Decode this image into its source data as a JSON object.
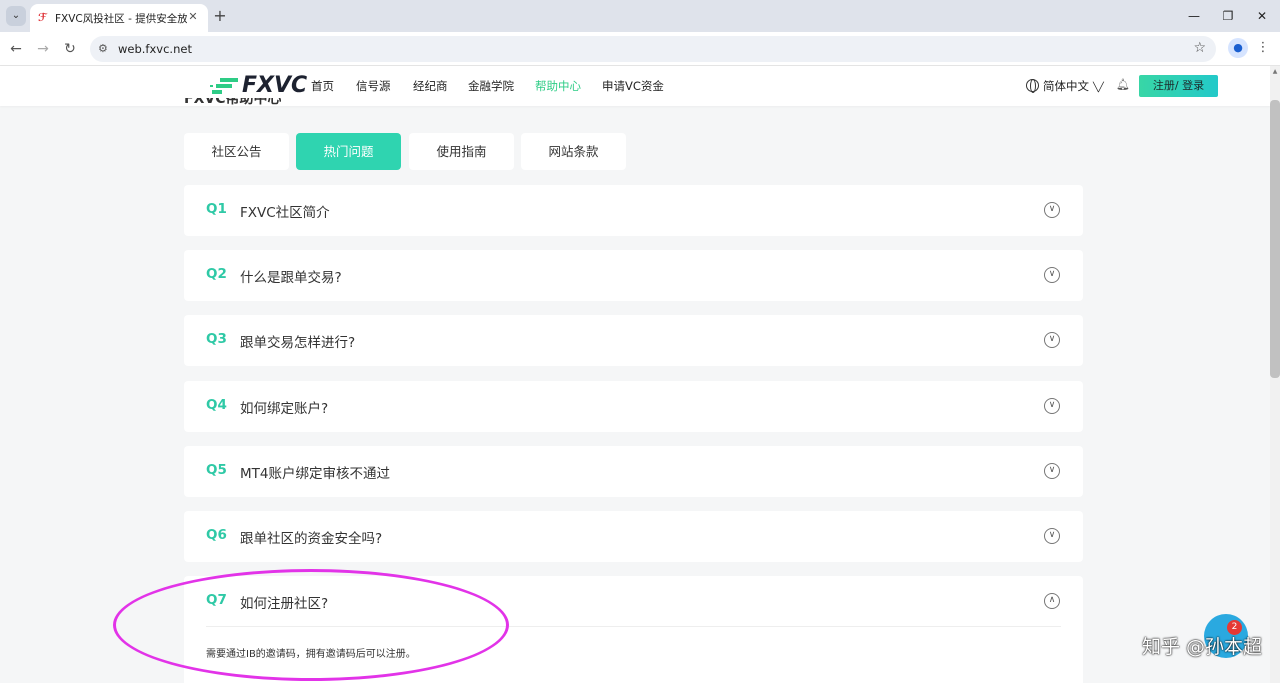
{
  "browser": {
    "tab_title": "FXVC风投社区 - 提供安全放心的",
    "url": "web.fxvc.net"
  },
  "header": {
    "logo_text": "FXVC",
    "nav": [
      "首页",
      "信号源",
      "经纪商",
      "金融学院",
      "帮助中心",
      "申请VC资金"
    ],
    "active_nav": "帮助中心",
    "language": "简体中文",
    "login_label": "注册/ 登录"
  },
  "page": {
    "title": "FXVC帮助中心",
    "tabs": [
      "社区公告",
      "热门问题",
      "使用指南",
      "网站条款"
    ],
    "active_tab": "热门问题"
  },
  "faq": [
    {
      "num": "Q1",
      "question": "FXVC社区简介"
    },
    {
      "num": "Q2",
      "question": "什么是跟单交易?"
    },
    {
      "num": "Q3",
      "question": "跟单交易怎样进行?"
    },
    {
      "num": "Q4",
      "question": "如何绑定账户?"
    },
    {
      "num": "Q5",
      "question": "MT4账户绑定审核不通过"
    },
    {
      "num": "Q6",
      "question": "跟单社区的资金安全吗?"
    },
    {
      "num": "Q7",
      "question": "如何注册社区?",
      "answer": "需要通过IB的邀请码，拥有邀请码后可以注册。",
      "expanded": true
    }
  ],
  "chat": {
    "badge_count": "2"
  },
  "watermark": "知乎 @孙本超",
  "colors": {
    "accent": "#2fd4b0",
    "active_nav": "#2ecc86",
    "annotation": "#e233e8",
    "chat": "#2aa9e0"
  }
}
